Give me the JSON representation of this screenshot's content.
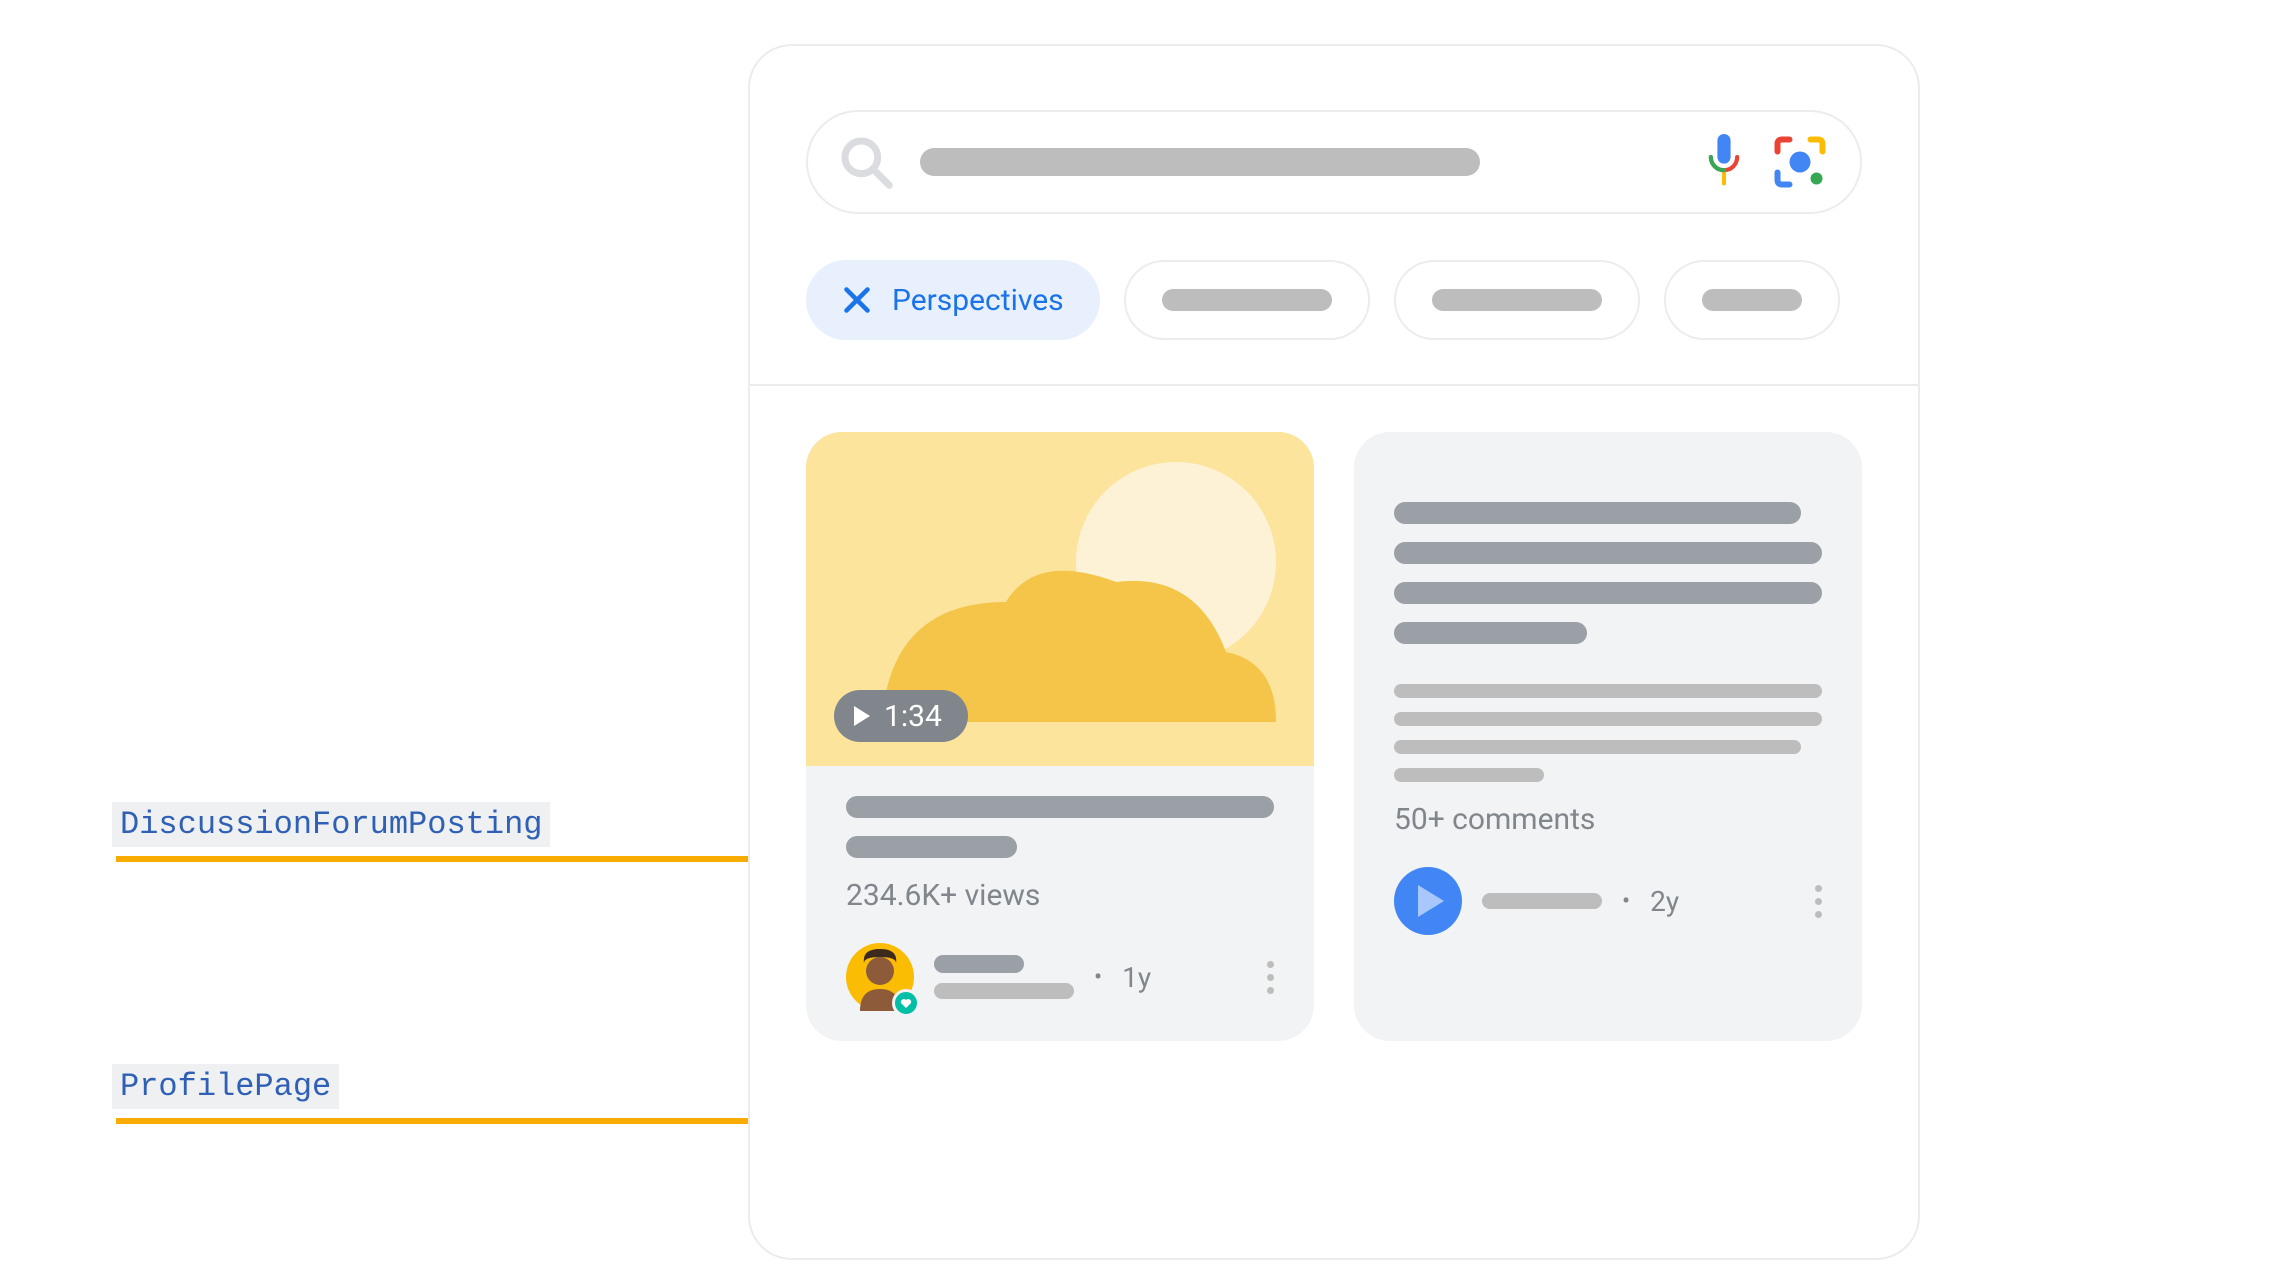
{
  "annotations": {
    "discussion": "DiscussionForumPosting",
    "profile": "ProfilePage"
  },
  "chips": {
    "active_label": "Perspectives"
  },
  "card1": {
    "duration": "1:34",
    "views": "234.6K+ views",
    "age": "1y"
  },
  "card2": {
    "comments": "50+ comments",
    "age": "2y"
  }
}
